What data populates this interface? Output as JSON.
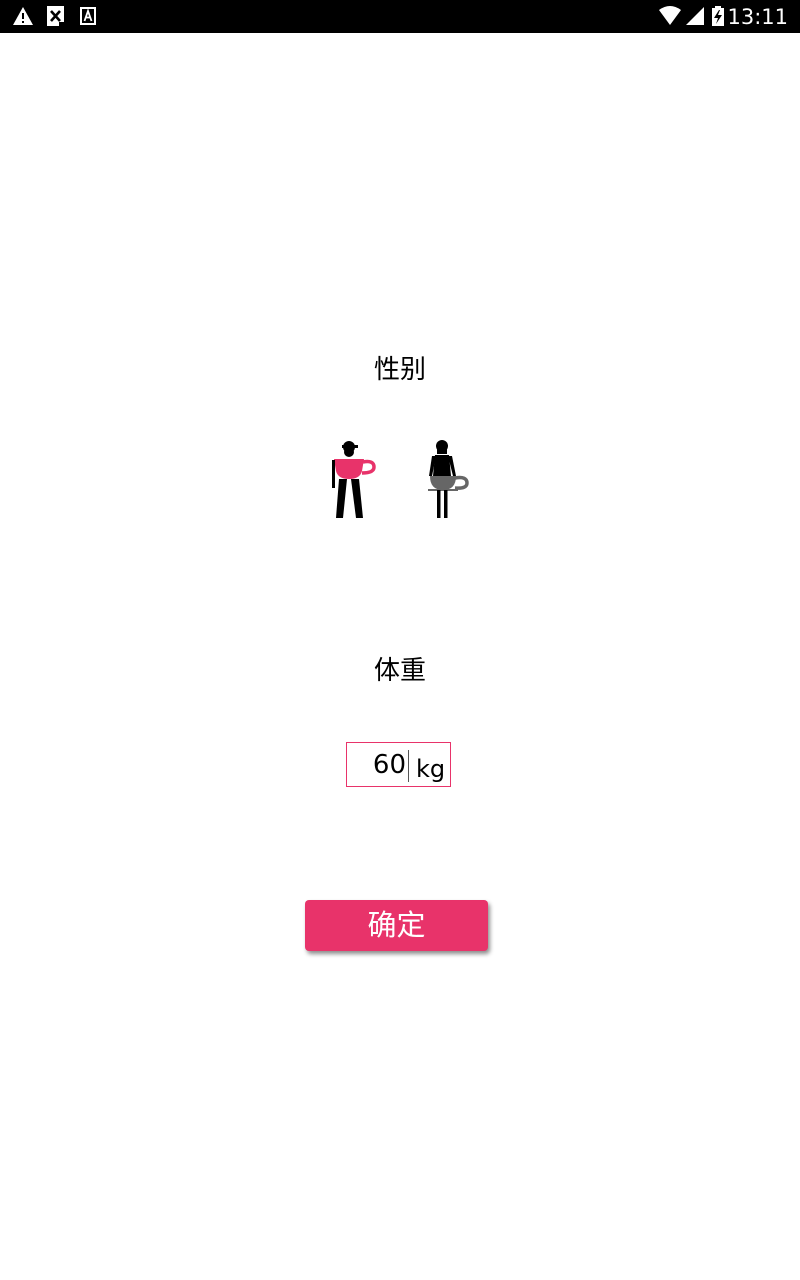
{
  "status_bar": {
    "time": "13:11",
    "left_icons": [
      "warning-icon",
      "sim-error-icon",
      "text-a-icon"
    ],
    "right_icons": [
      "wifi-icon",
      "cell-signal-icon",
      "battery-charging-icon"
    ]
  },
  "gender": {
    "label": "性别",
    "options": [
      {
        "name": "male",
        "icon": "male-figure-icon",
        "selected": true
      },
      {
        "name": "female",
        "icon": "female-figure-icon",
        "selected": false
      }
    ]
  },
  "weight": {
    "label": "体重",
    "value": "60",
    "unit": "kg"
  },
  "confirm": {
    "label": "确定"
  },
  "colors": {
    "accent": "#e8336a",
    "unselected": "#666666",
    "status_bar": "#000000"
  }
}
